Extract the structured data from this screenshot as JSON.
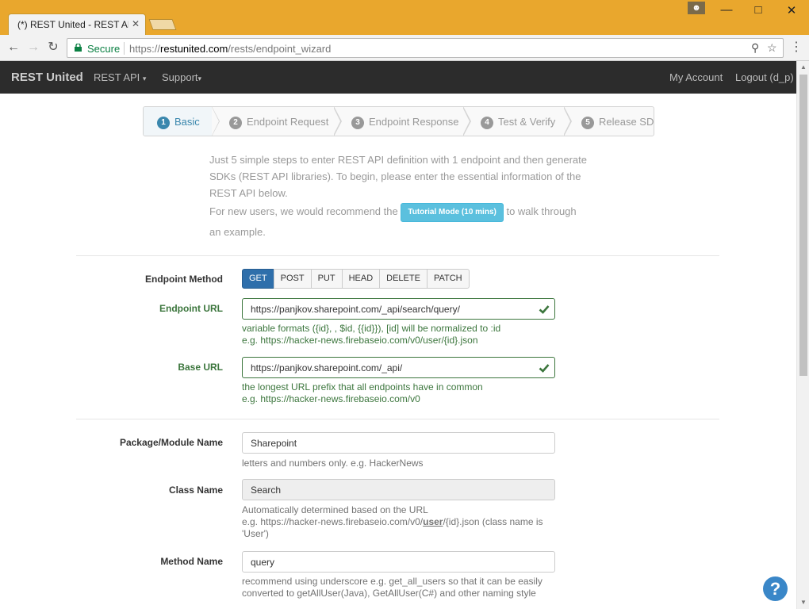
{
  "browser": {
    "tab_title": "(*) REST United - REST API n",
    "secure_label": "Secure",
    "url_scheme": "https://",
    "url_host": "restunited.com",
    "url_path": "/rests/endpoint_wizard"
  },
  "navbar": {
    "brand": "REST United",
    "rest_api": "REST API",
    "support": "Support",
    "my_account": "My Account",
    "logout": "Logout (d_p)"
  },
  "wizard": {
    "steps": [
      {
        "num": "1",
        "label": "Basic",
        "active": true
      },
      {
        "num": "2",
        "label": "Endpoint Request",
        "active": false
      },
      {
        "num": "3",
        "label": "Endpoint Response",
        "active": false
      },
      {
        "num": "4",
        "label": "Test & Verify",
        "active": false
      },
      {
        "num": "5",
        "label": "Release SDK",
        "active": false
      }
    ]
  },
  "intro": {
    "line1": "Just 5 simple steps to enter REST API definition with 1 endpoint and then generate SDKs (REST API libraries). To begin, please enter the essential information of the REST API below.",
    "line2_pre": "For new users, we would recommend the",
    "tutorial_button": "Tutorial Mode (10 mins)",
    "line2_post": "to walk through an example."
  },
  "form": {
    "endpoint_method": {
      "label": "Endpoint Method",
      "options": [
        "GET",
        "POST",
        "PUT",
        "HEAD",
        "DELETE",
        "PATCH"
      ],
      "selected": "GET"
    },
    "endpoint_url": {
      "label": "Endpoint URL",
      "value": "https://panjkov.sharepoint.com/_api/search/query/",
      "help1": "variable formats ({id}, , $id, {{id}}), [id] will be normalized to :id",
      "help2": "e.g. https://hacker-news.firebaseio.com/v0/user/{id}.json"
    },
    "base_url": {
      "label": "Base URL",
      "value": "https://panjkov.sharepoint.com/_api/",
      "help1": "the longest URL prefix that all endpoints have in common",
      "help2": "e.g. https://hacker-news.firebaseio.com/v0"
    },
    "package_name": {
      "label": "Package/Module Name",
      "value": "Sharepoint",
      "help": "letters and numbers only. e.g. HackerNews"
    },
    "class_name": {
      "label": "Class Name",
      "value": "Search",
      "help1": "Automatically determined based on the URL",
      "help2_pre": "e.g. https://hacker-news.firebaseio.com/v0/",
      "help2_bold": "user",
      "help2_post": "/{id}.json (class name is 'User')"
    },
    "method_name": {
      "label": "Method Name",
      "value": "query",
      "help": "recommend using underscore e.g. get_all_users so that it can be easily converted to getAllUser(Java), GetAllUser(C#) and other naming style"
    }
  },
  "colors": {
    "accent": "#3a87ad",
    "success": "#3c763d",
    "chrome": "#e9a72d"
  }
}
